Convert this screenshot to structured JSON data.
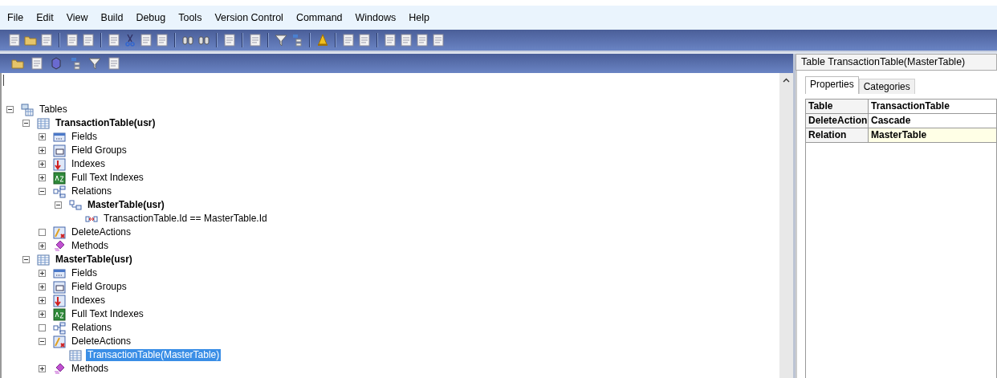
{
  "menu": [
    "File",
    "Edit",
    "View",
    "Build",
    "Debug",
    "Tools",
    "Version Control",
    "Command",
    "Windows",
    "Help"
  ],
  "tree": [
    {
      "label": "Tables",
      "kind": "tables",
      "toggle_box": true,
      "expanded": true,
      "bold": false,
      "selected": false,
      "children": [
        {
          "label": "TransactionTable(usr)",
          "kind": "table",
          "toggle_box": true,
          "expanded": true,
          "bold": true,
          "selected": false,
          "children": [
            {
              "label": "Fields",
              "kind": "fields",
              "toggle_box": true,
              "expanded": false,
              "bold": false,
              "selected": false
            },
            {
              "label": "Field Groups",
              "kind": "field-groups",
              "toggle_box": true,
              "expanded": false,
              "bold": false,
              "selected": false
            },
            {
              "label": "Indexes",
              "kind": "indexes",
              "toggle_box": true,
              "expanded": false,
              "bold": false,
              "selected": false
            },
            {
              "label": "Full Text Indexes",
              "kind": "fulltext",
              "toggle_box": true,
              "expanded": false,
              "bold": false,
              "selected": false
            },
            {
              "label": "Relations",
              "kind": "relations",
              "toggle_box": true,
              "expanded": true,
              "bold": false,
              "selected": false,
              "children": [
                {
                  "label": "MasterTable(usr)",
                  "kind": "relation",
                  "toggle_box": true,
                  "expanded": true,
                  "bold": true,
                  "selected": false,
                  "children": [
                    {
                      "label": "TransactionTable.Id == MasterTable.Id",
                      "kind": "link",
                      "bold": false,
                      "selected": false
                    }
                  ]
                }
              ]
            },
            {
              "label": "DeleteActions",
              "kind": "delete-actions",
              "toggle_box": true,
              "empty": true,
              "bold": false,
              "selected": false
            },
            {
              "label": "Methods",
              "kind": "methods",
              "toggle_box": true,
              "expanded": false,
              "bold": false,
              "selected": false
            }
          ]
        },
        {
          "label": "MasterTable(usr)",
          "kind": "table",
          "toggle_box": true,
          "expanded": true,
          "bold": true,
          "selected": false,
          "children": [
            {
              "label": "Fields",
              "kind": "fields",
              "toggle_box": true,
              "expanded": false,
              "bold": false,
              "selected": false
            },
            {
              "label": "Field Groups",
              "kind": "field-groups",
              "toggle_box": true,
              "expanded": false,
              "bold": false,
              "selected": false
            },
            {
              "label": "Indexes",
              "kind": "indexes",
              "toggle_box": true,
              "expanded": false,
              "bold": false,
              "selected": false
            },
            {
              "label": "Full Text Indexes",
              "kind": "fulltext",
              "toggle_box": true,
              "expanded": false,
              "bold": false,
              "selected": false
            },
            {
              "label": "Relations",
              "kind": "relations",
              "toggle_box": true,
              "empty": true,
              "bold": false,
              "selected": false
            },
            {
              "label": "DeleteActions",
              "kind": "delete-actions",
              "toggle_box": true,
              "expanded": true,
              "bold": false,
              "selected": false,
              "children": [
                {
                  "label": "TransactionTable(MasterTable)",
                  "kind": "table",
                  "bold": false,
                  "selected": true
                }
              ]
            },
            {
              "label": "Methods",
              "kind": "methods",
              "toggle_box": true,
              "expanded": false,
              "bold": false,
              "selected": false
            }
          ]
        }
      ]
    }
  ],
  "properties": {
    "title": "Table TransactionTable(MasterTable)",
    "tabs": [
      {
        "label": "Properties",
        "selected": true
      },
      {
        "label": "Categories",
        "selected": false
      }
    ],
    "rows": [
      {
        "name": "Table",
        "value": "TransactionTable",
        "selected": false
      },
      {
        "name": "DeleteAction",
        "value": "Cascade",
        "selected": false
      },
      {
        "name": "Relation",
        "value": "MasterTable",
        "selected": true
      }
    ]
  }
}
